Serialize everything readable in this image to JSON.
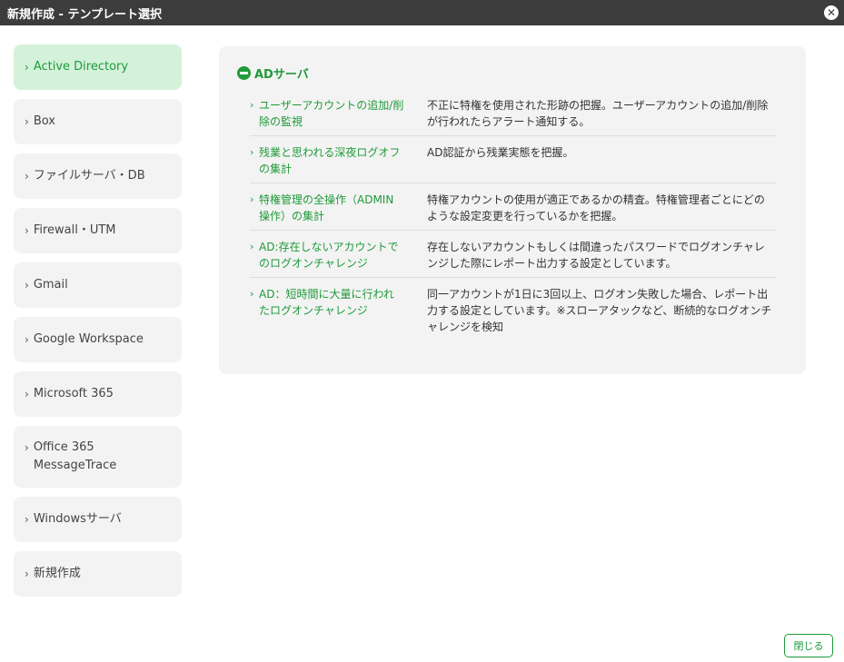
{
  "window": {
    "title": "新規作成 - テンプレート選択",
    "close_glyph": "✕"
  },
  "sidebar": {
    "items": [
      {
        "label": "Active Directory",
        "active": true
      },
      {
        "label": "Box"
      },
      {
        "label": "ファイルサーバ・DB"
      },
      {
        "label": "Firewall・UTM"
      },
      {
        "label": "Gmail"
      },
      {
        "label": "Google Workspace"
      },
      {
        "label": "Microsoft 365"
      },
      {
        "label": "Office 365 MessageTrace"
      },
      {
        "label": "Windowsサーバ"
      },
      {
        "label": "新規作成"
      }
    ]
  },
  "panel": {
    "section_title": "ADサーバ",
    "rows": [
      {
        "name": "ユーザーアカウントの追加/削除の監視",
        "desc": "不正に特権を使用された形跡の把握。ユーザーアカウントの追加/削除が行われたらアラート通知する。"
      },
      {
        "name": "残業と思われる深夜ログオフの集計",
        "desc": "AD認証から残業実態を把握。"
      },
      {
        "name": "特権管理の全操作（ADMIN操作）の集計",
        "desc": "特権アカウントの使用が適正であるかの精査。特権管理者ごとにどのような設定変更を行っているかを把握。"
      },
      {
        "name": "AD:存在しないアカウントでのログオンチャレンジ",
        "desc": "存在しないアカウントもしくは間違ったパスワードでログオンチャレンジした際にレポート出力する設定としています。"
      },
      {
        "name": "AD：短時間に大量に行われたログオンチャレンジ",
        "desc": "同一アカウントが1日に3回以上、ログオン失敗した場合、レポート出力する設定としています。※スローアタックなど、断続的なログオンチャレンジを検知"
      }
    ]
  },
  "footer": {
    "close_label": "閉じる"
  },
  "colors": {
    "accent": "#1f9a3a",
    "titlebar": "#3c3c3c",
    "active_bg": "#d3f2d9"
  }
}
